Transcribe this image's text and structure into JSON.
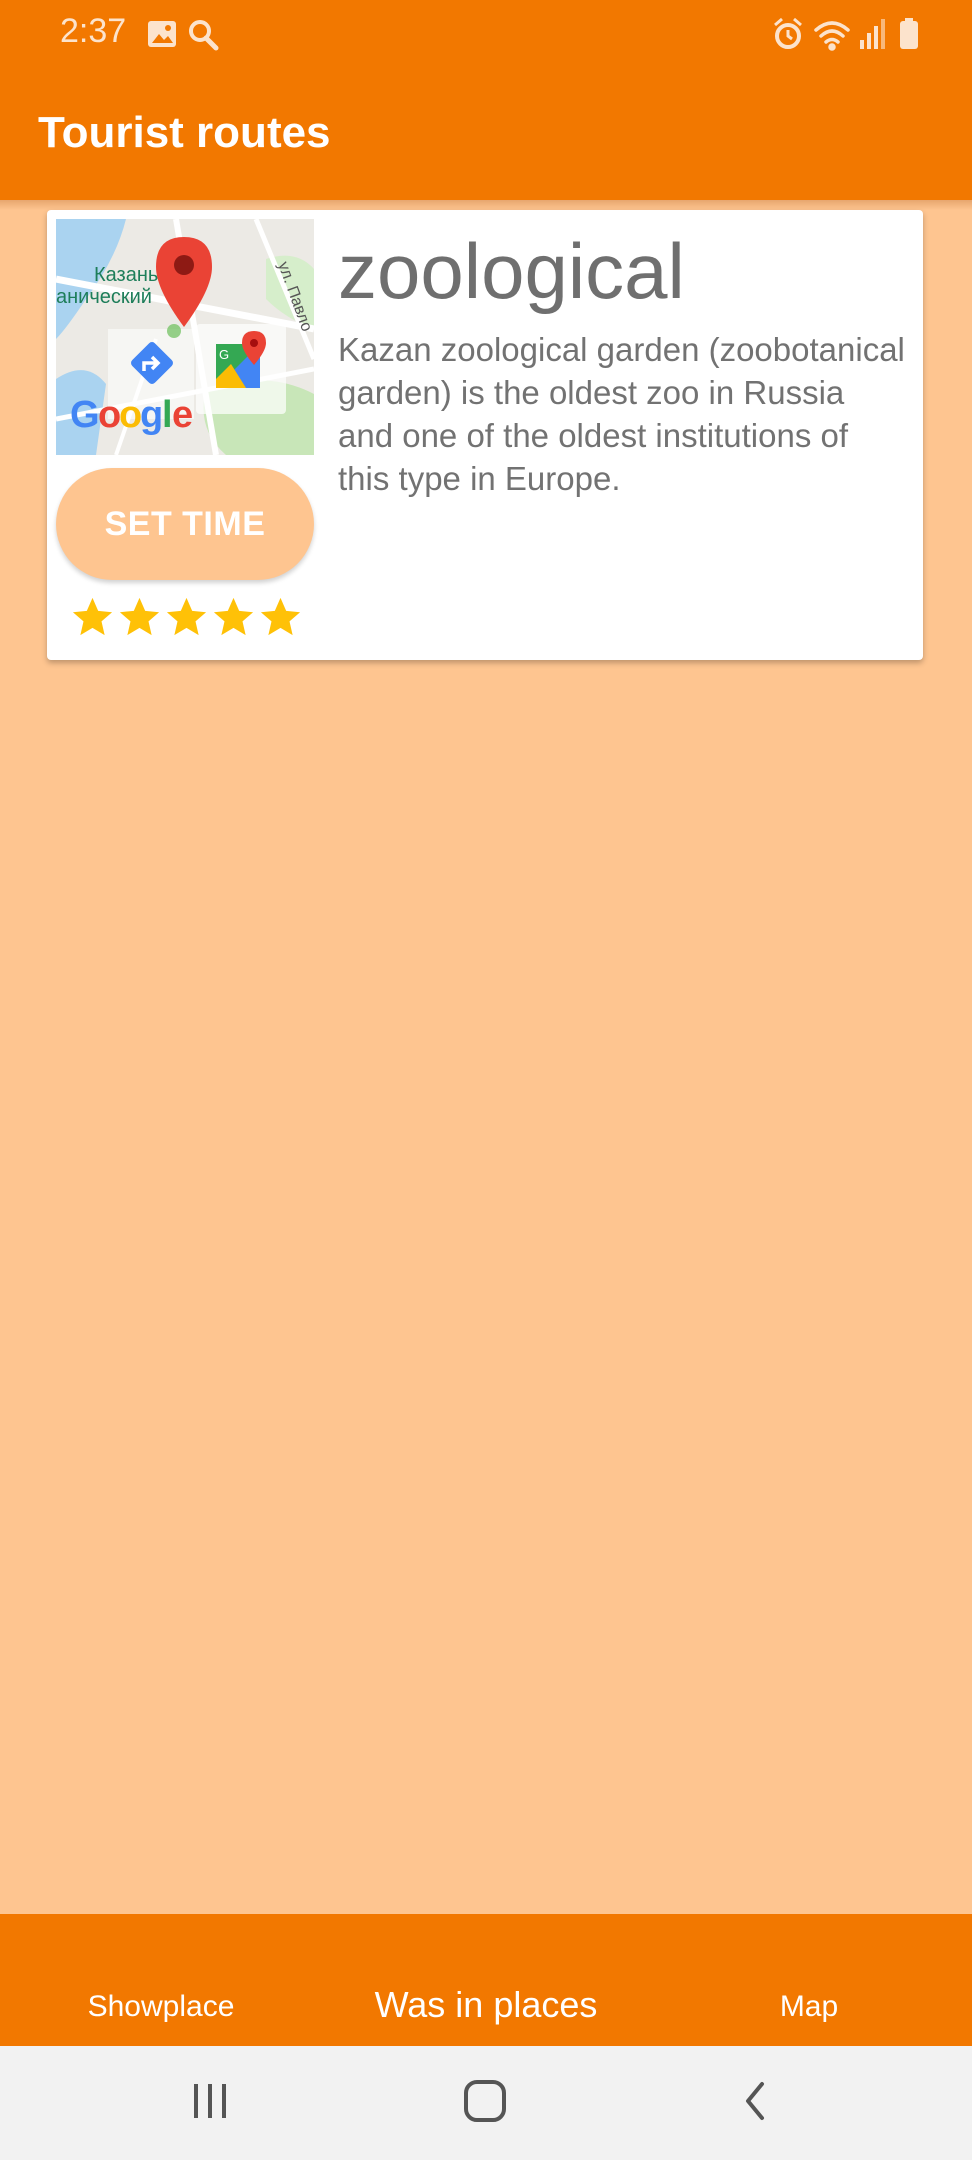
{
  "status_bar": {
    "time": "2:37",
    "left_icons": [
      "image-icon",
      "search-icon"
    ],
    "right_icons": [
      "alarm-icon",
      "wifi-icon",
      "signal-icon",
      "battery-icon"
    ]
  },
  "app_bar": {
    "title": "Tourist routes"
  },
  "place": {
    "title": "zoological",
    "description": "Kazan zoological garden (zoobotanical garden) is the oldest zoo in Russia and one of the oldest institutions of this type in Europe.",
    "map_labels": {
      "city": "Казань",
      "district": "анический",
      "street": "ул. Павло",
      "logo": "Google"
    },
    "set_time_label": "SET TIME",
    "rating": {
      "value": 5,
      "max": 5
    }
  },
  "bottom_nav": {
    "items": [
      {
        "label": "Showplace"
      },
      {
        "label": "Was in places"
      },
      {
        "label": "Map"
      }
    ]
  },
  "colors": {
    "primary": "#F27800",
    "background": "#FEC590",
    "star": "#FFC107"
  }
}
